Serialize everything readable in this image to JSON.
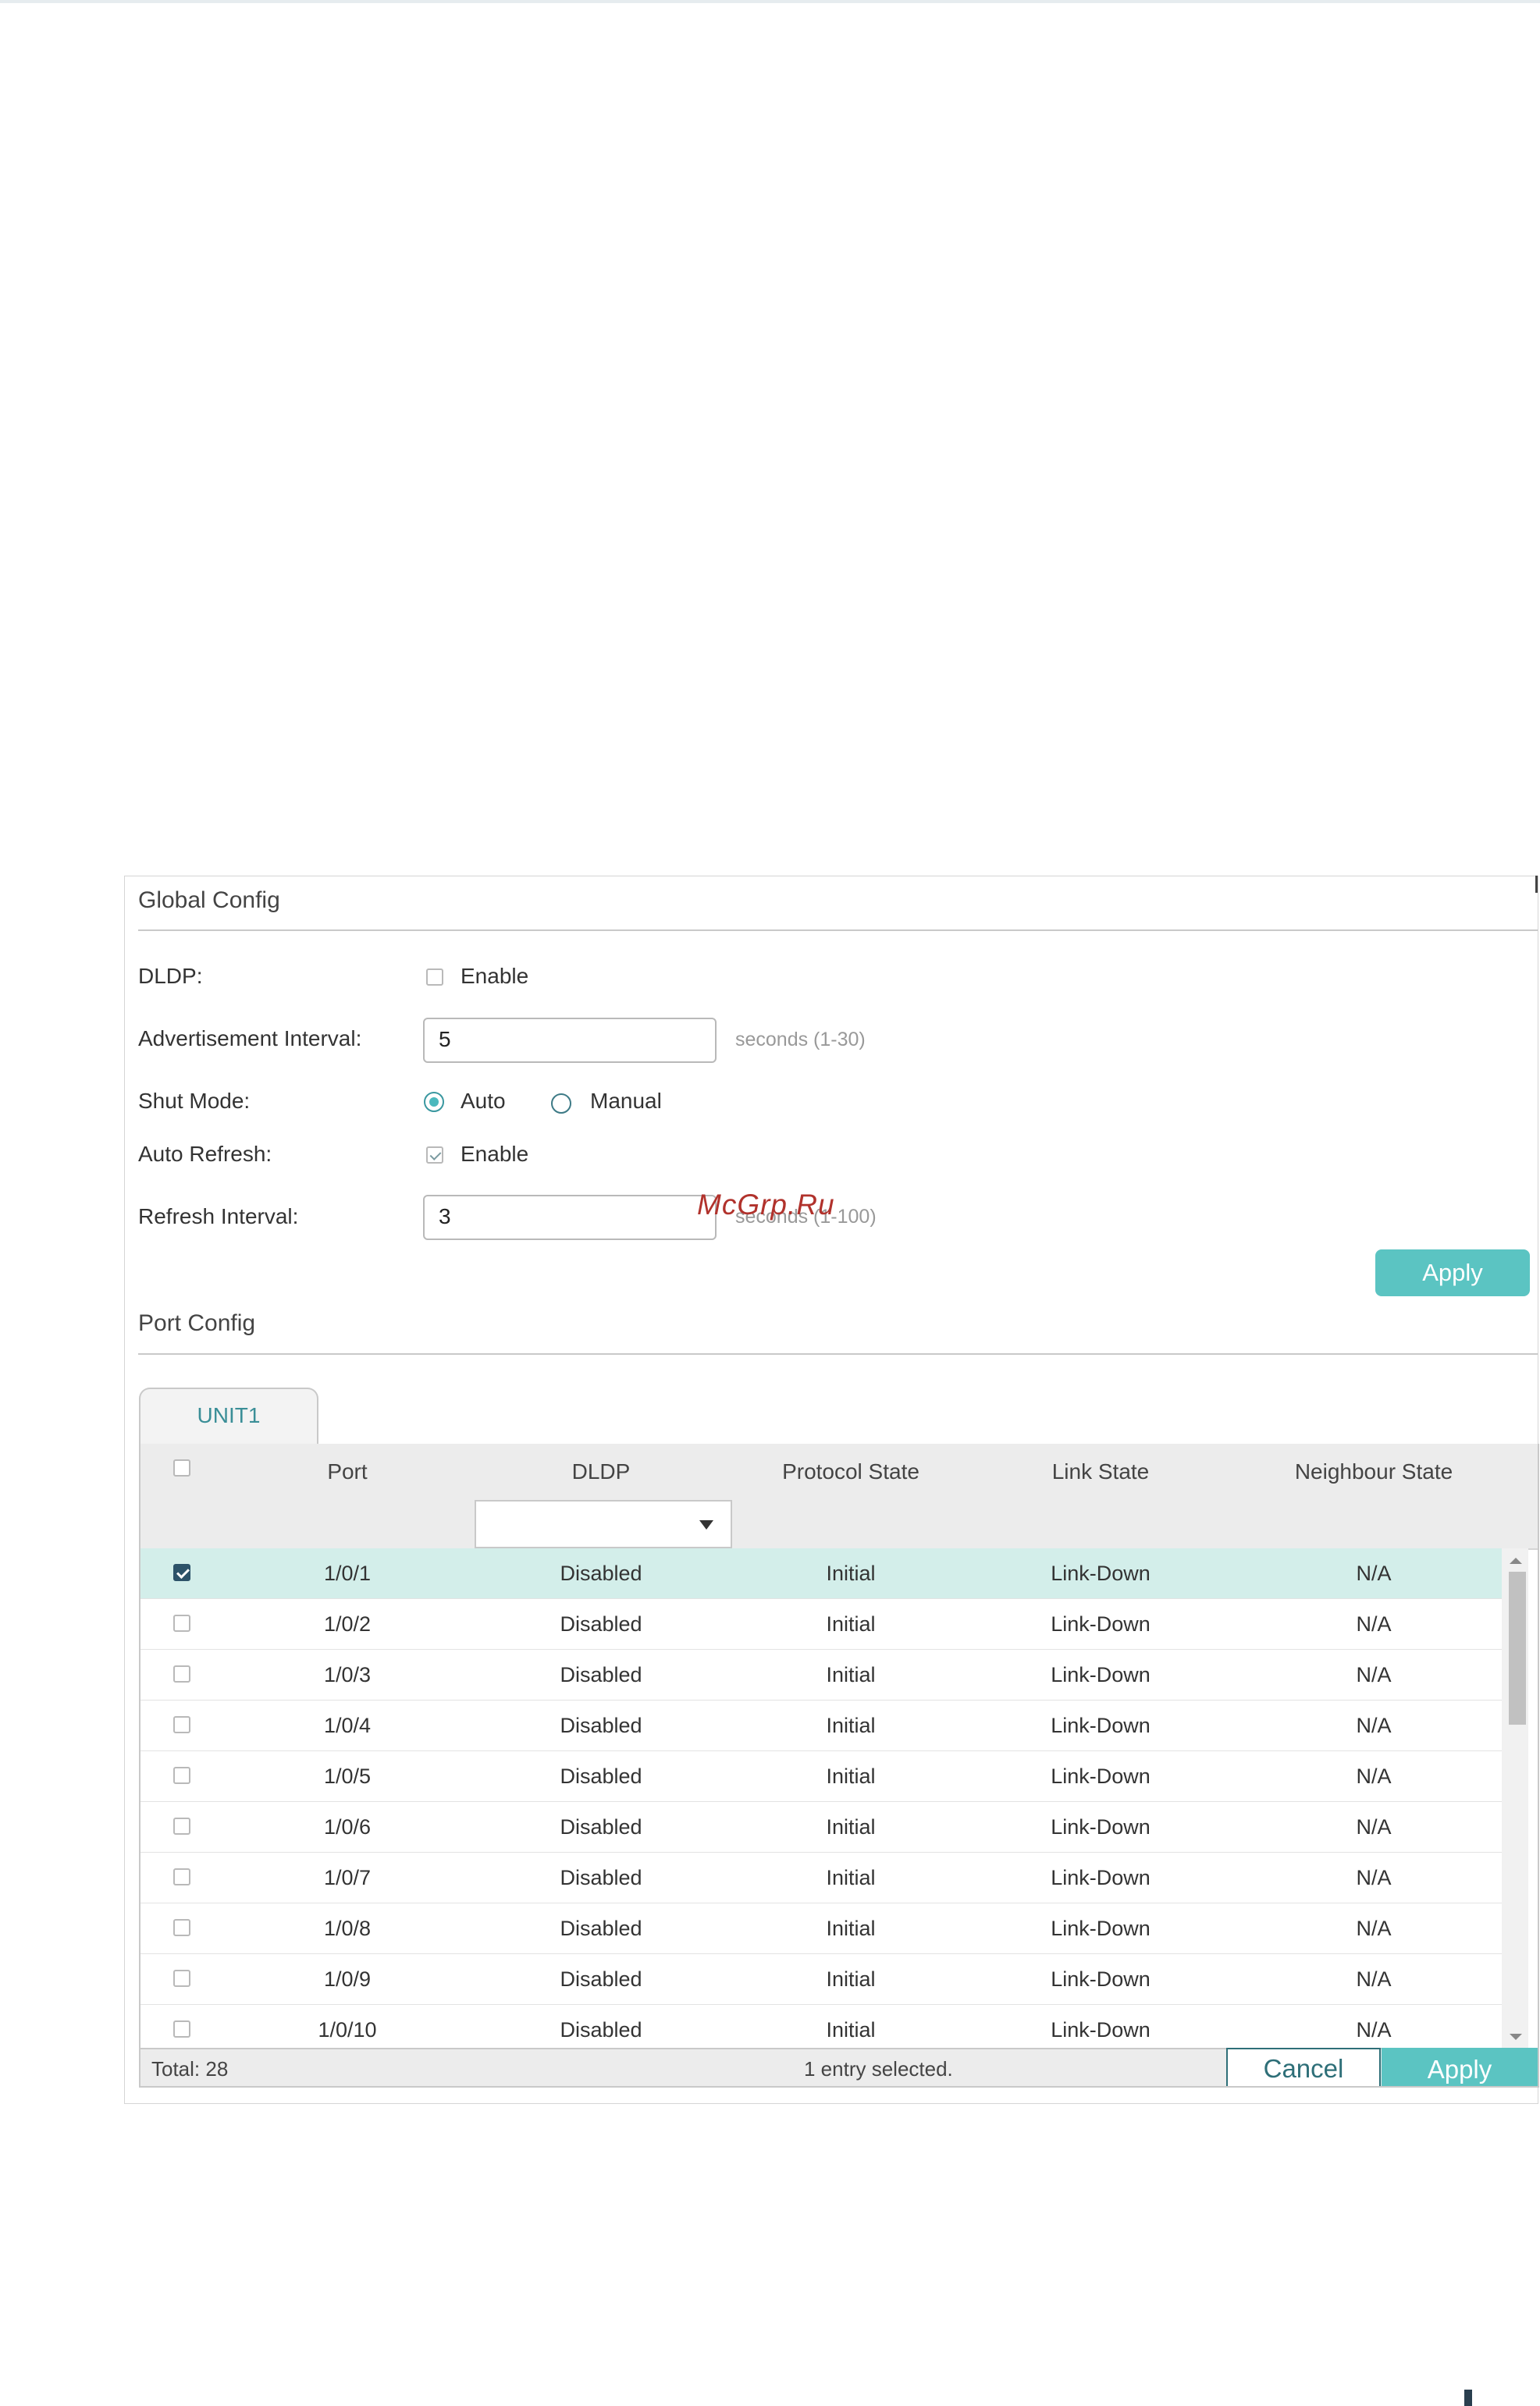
{
  "watermark": "McGrp.Ru",
  "global_config": {
    "title": "Global Config",
    "dldp_label": "DLDP:",
    "dldp_enable_text": "Enable",
    "dldp_enabled": false,
    "adv_interval_label": "Advertisement Interval:",
    "adv_interval_value": "5",
    "adv_interval_hint": "seconds (1-30)",
    "shut_mode_label": "Shut Mode:",
    "shut_mode_options": [
      "Auto",
      "Manual"
    ],
    "shut_mode_selected": "Auto",
    "auto_refresh_label": "Auto Refresh:",
    "auto_refresh_enable_text": "Enable",
    "auto_refresh_enabled": true,
    "refresh_interval_label": "Refresh Interval:",
    "refresh_interval_value": "3",
    "refresh_interval_hint": "seconds (1-100)",
    "apply_label": "Apply"
  },
  "port_config": {
    "title": "Port Config",
    "tab_label": "UNIT1",
    "columns": [
      "Port",
      "DLDP",
      "Protocol State",
      "Link State",
      "Neighbour State"
    ],
    "filter_dldp_value": "",
    "rows": [
      {
        "port": "1/0/1",
        "dldp": "Disabled",
        "protocol_state": "Initial",
        "link_state": "Link-Down",
        "neighbour_state": "N/A",
        "selected": true
      },
      {
        "port": "1/0/2",
        "dldp": "Disabled",
        "protocol_state": "Initial",
        "link_state": "Link-Down",
        "neighbour_state": "N/A",
        "selected": false
      },
      {
        "port": "1/0/3",
        "dldp": "Disabled",
        "protocol_state": "Initial",
        "link_state": "Link-Down",
        "neighbour_state": "N/A",
        "selected": false
      },
      {
        "port": "1/0/4",
        "dldp": "Disabled",
        "protocol_state": "Initial",
        "link_state": "Link-Down",
        "neighbour_state": "N/A",
        "selected": false
      },
      {
        "port": "1/0/5",
        "dldp": "Disabled",
        "protocol_state": "Initial",
        "link_state": "Link-Down",
        "neighbour_state": "N/A",
        "selected": false
      },
      {
        "port": "1/0/6",
        "dldp": "Disabled",
        "protocol_state": "Initial",
        "link_state": "Link-Down",
        "neighbour_state": "N/A",
        "selected": false
      },
      {
        "port": "1/0/7",
        "dldp": "Disabled",
        "protocol_state": "Initial",
        "link_state": "Link-Down",
        "neighbour_state": "N/A",
        "selected": false
      },
      {
        "port": "1/0/8",
        "dldp": "Disabled",
        "protocol_state": "Initial",
        "link_state": "Link-Down",
        "neighbour_state": "N/A",
        "selected": false
      },
      {
        "port": "1/0/9",
        "dldp": "Disabled",
        "protocol_state": "Initial",
        "link_state": "Link-Down",
        "neighbour_state": "N/A",
        "selected": false
      },
      {
        "port": "1/0/10",
        "dldp": "Disabled",
        "protocol_state": "Initial",
        "link_state": "Link-Down",
        "neighbour_state": "N/A",
        "selected": false
      }
    ],
    "footer_total": "Total: 28",
    "footer_selected": "1 entry selected.",
    "cancel_label": "Cancel",
    "apply_label": "Apply"
  },
  "colors": {
    "accent": "#5bc4c2",
    "selected_row": "#d3eeea",
    "checkbox_checked": "#2c5269",
    "watermark": "#b1322c"
  }
}
